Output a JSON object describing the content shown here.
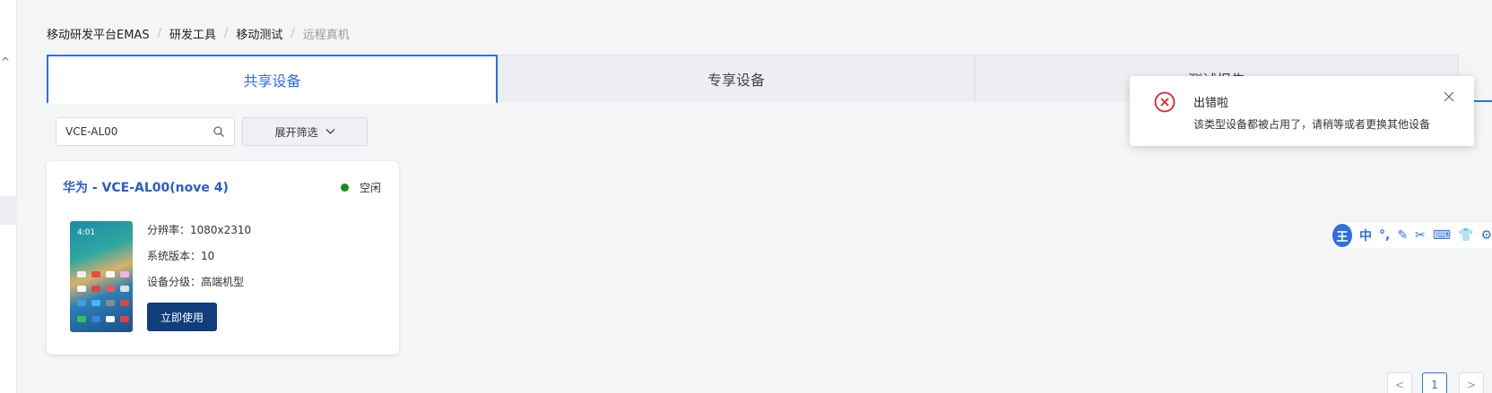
{
  "breadcrumb": [
    "移动研发平台EMAS",
    "研发工具",
    "移动测试",
    "远程真机"
  ],
  "tabs": [
    {
      "label": "共享设备"
    },
    {
      "label": "专享设备"
    },
    {
      "label": "测试报告"
    }
  ],
  "search": {
    "value": "VCE-AL00",
    "icon": "search-icon"
  },
  "filter": {
    "label": "展开筛选",
    "icon": "chevron-down-icon"
  },
  "device_card": {
    "title": "华为 - VCE-AL00(nove 4)",
    "status": "空闲",
    "status_color": "#1a8a1a",
    "phone_time": "4:01",
    "specs": [
      "分辨率：1080x2310",
      "系统版本：10",
      "设备分级：高端机型"
    ],
    "use_button": "立即使用"
  },
  "toast": {
    "title": "出错啦",
    "message": "该类型设备都被占用了，请稍等或者更换其他设备",
    "icon": "error-circle-icon",
    "error_color": "#d9262c"
  },
  "ime_toolbar": {
    "logo": "王",
    "items": [
      "中",
      "°,",
      "✎",
      "✂",
      "⌨",
      "👕",
      "⚙"
    ]
  },
  "pagination": {
    "prev": "<",
    "current": "1",
    "next": ">"
  },
  "colors": {
    "accent": "#2f6fe0",
    "primary_button": "#0f3e7a",
    "background": "#f4f5f7"
  }
}
